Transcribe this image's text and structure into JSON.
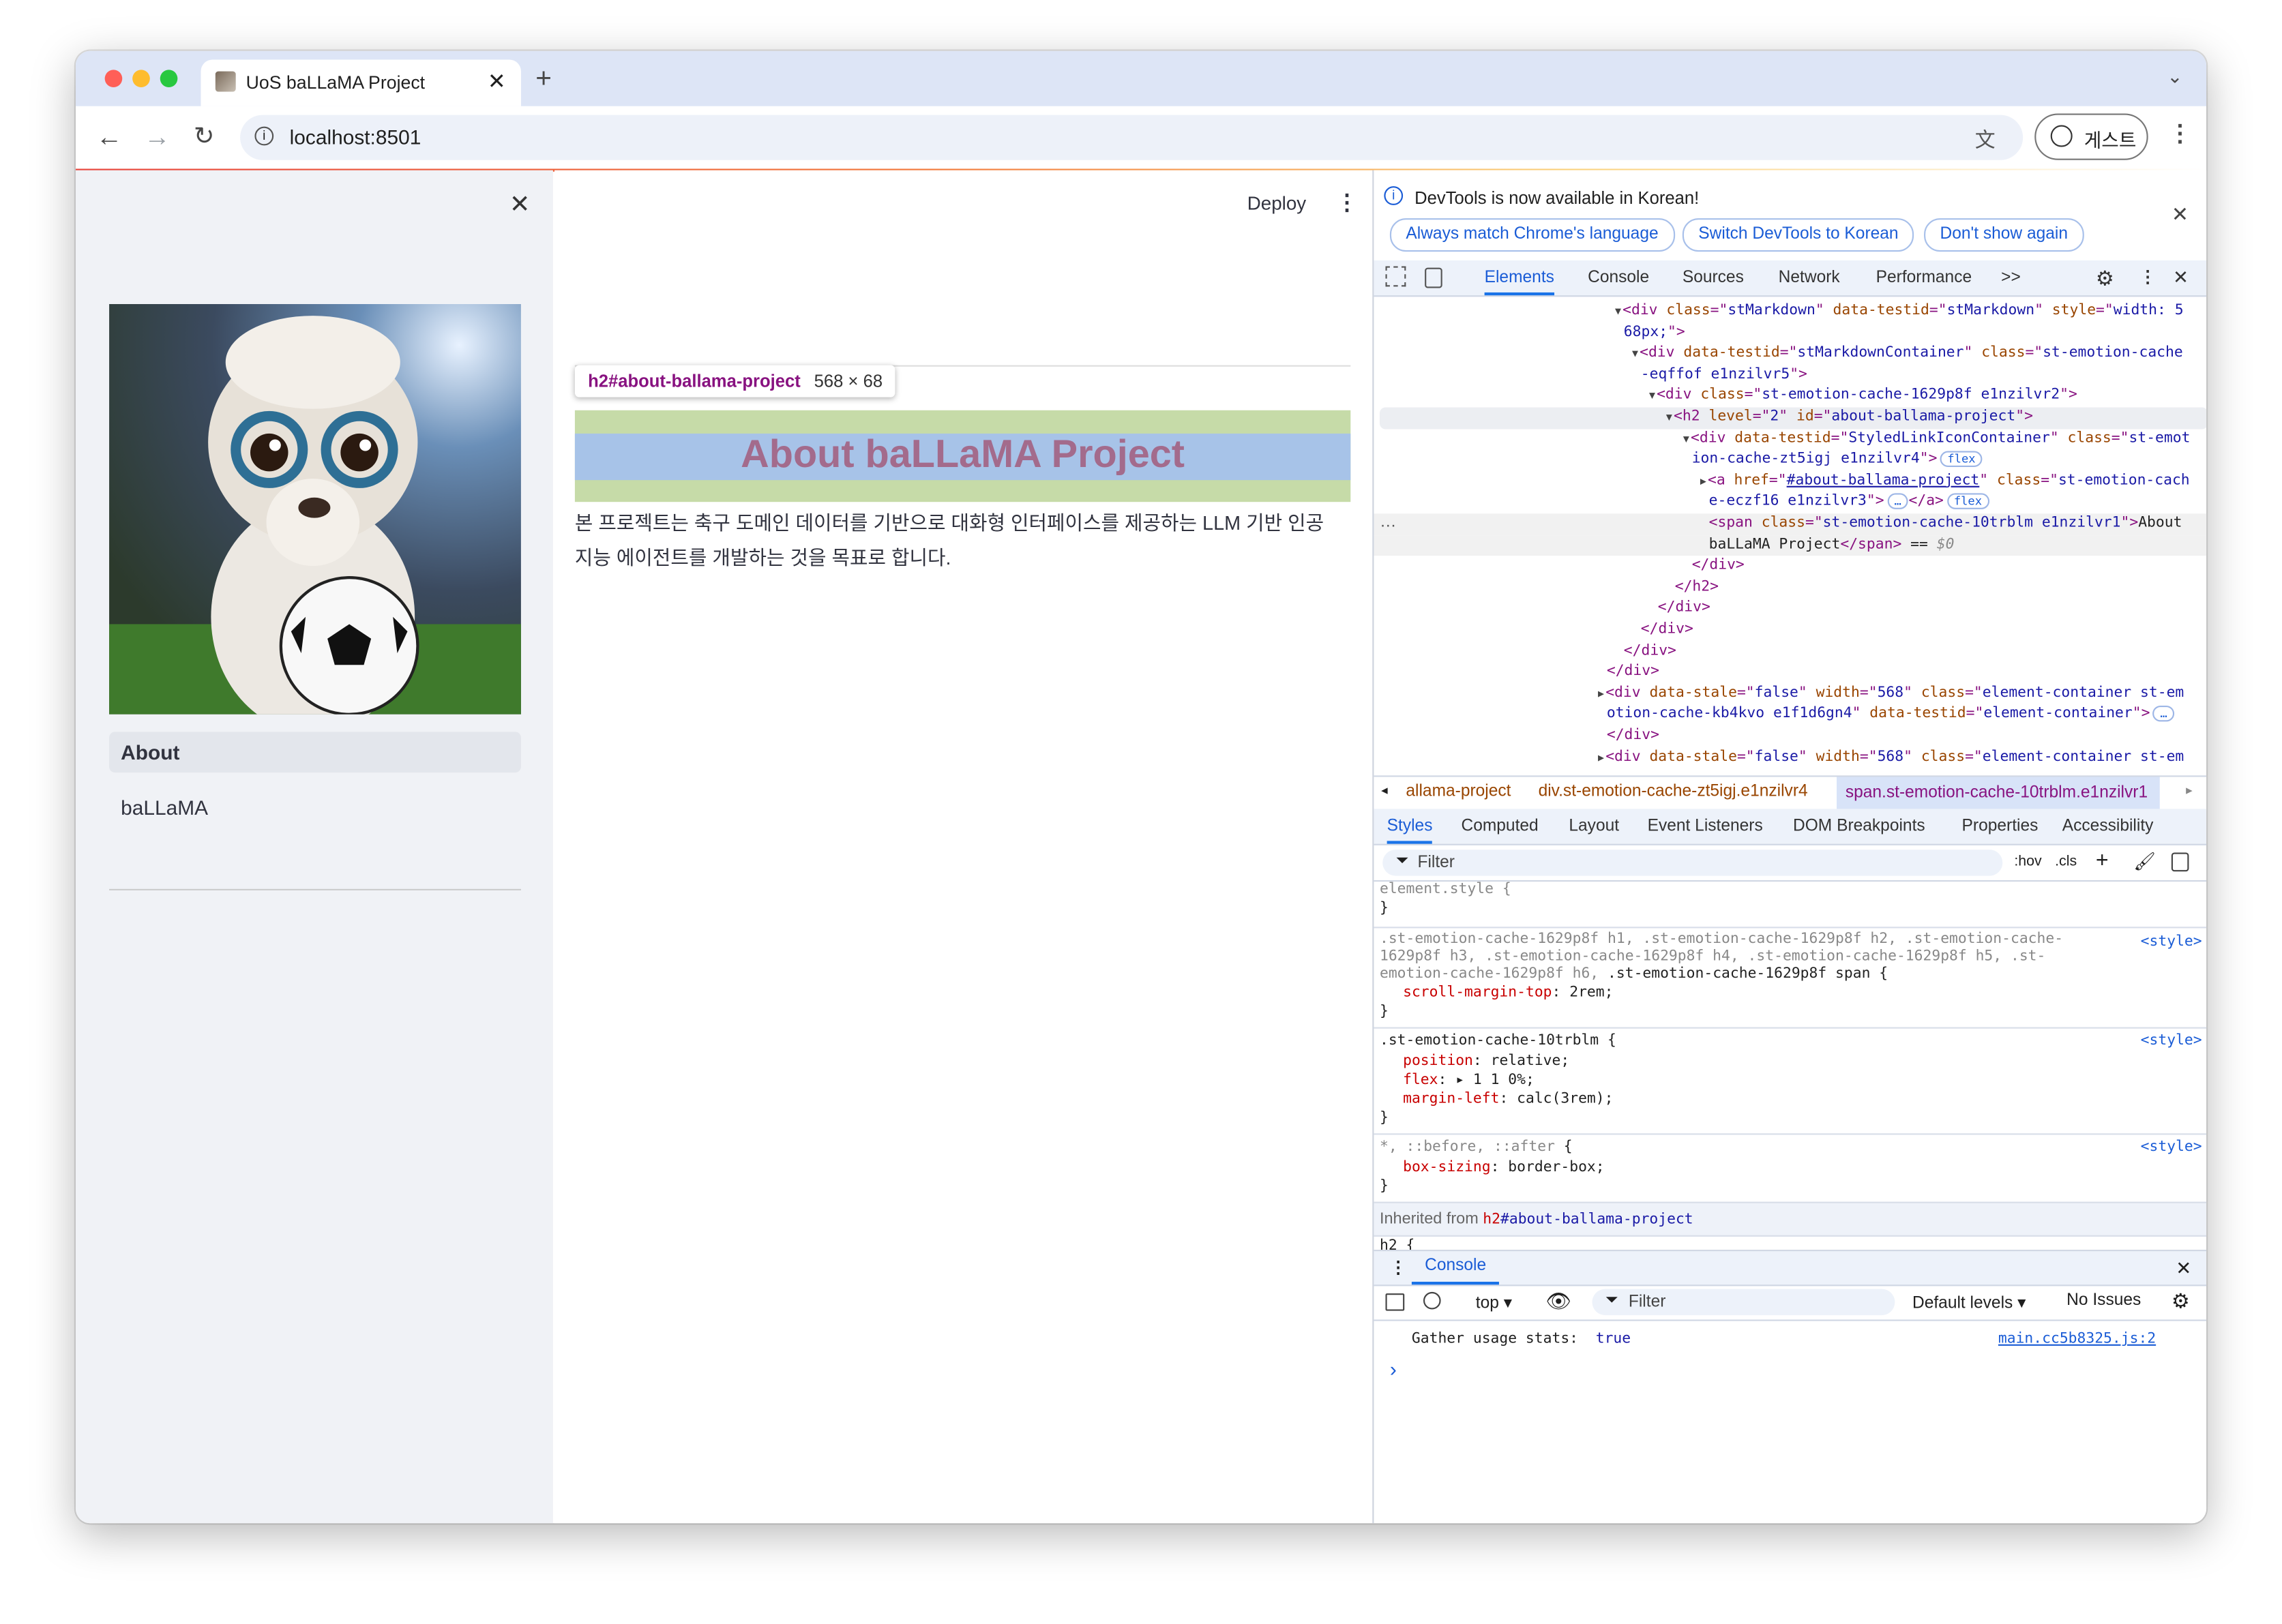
{
  "browser": {
    "tab_title": "UoS baLLaMA Project",
    "url": "localhost:8501",
    "profile_label": "게스트",
    "icons": [
      "back-icon",
      "forward-icon",
      "reload-icon",
      "site-info-icon",
      "translate-icon",
      "profile-icon",
      "menu-icon",
      "new-tab-icon",
      "tab-list-icon"
    ]
  },
  "sidebar": {
    "items": [
      {
        "label": "About",
        "active": true
      },
      {
        "label": "baLLaMA",
        "active": false
      }
    ]
  },
  "main": {
    "deploy_label": "Deploy",
    "tooltip_selector": "h2#about-ballama-project",
    "tooltip_size": "568 × 68",
    "heading": "About baLLaMA Project",
    "paragraph_line1": "본 프로젝트는 축구 도메인 데이터를 기반으로 대화형 인터페이스를 제공하는 LLM 기반 인공",
    "paragraph_line2": "지능 에이전트를 개발하는 것을 목표로 합니다."
  },
  "devtools": {
    "notice": "DevTools is now available in Korean!",
    "notice_buttons": [
      "Always match Chrome's language",
      "Switch DevTools to Korean",
      "Don't show again"
    ],
    "tabs": [
      "Elements",
      "Console",
      "Sources",
      "Network",
      "Performance"
    ],
    "active_tab": "Elements",
    "more_tabs": ">>",
    "dom_lines": [
      {
        "depth": 1,
        "arrow": "down",
        "tokens": [
          [
            "tag",
            "<div "
          ],
          [
            "attr",
            "class"
          ],
          [
            "tag",
            "=\""
          ],
          [
            "val",
            "stMarkdown"
          ],
          [
            "tag",
            "\" "
          ],
          [
            "attr",
            "data-testid"
          ],
          [
            "tag",
            "=\""
          ],
          [
            "val",
            "stMarkdown"
          ],
          [
            "tag",
            "\" "
          ],
          [
            "attr",
            "style"
          ],
          [
            "tag",
            "=\""
          ],
          [
            "val",
            "width: 5"
          ]
        ]
      },
      {
        "depth": 1,
        "arrow": "none",
        "tokens": [
          [
            "val",
            "68px;"
          ],
          [
            "tag",
            "\">"
          ]
        ]
      },
      {
        "depth": 2,
        "arrow": "down",
        "tokens": [
          [
            "tag",
            "<div "
          ],
          [
            "attr",
            "data-testid"
          ],
          [
            "tag",
            "=\""
          ],
          [
            "val",
            "stMarkdownContainer"
          ],
          [
            "tag",
            "\" "
          ],
          [
            "attr",
            "class"
          ],
          [
            "tag",
            "=\""
          ],
          [
            "val",
            "st-emotion-cache"
          ]
        ]
      },
      {
        "depth": 2,
        "arrow": "none",
        "tokens": [
          [
            "val",
            "-eqffof e1nzilvr5"
          ],
          [
            "tag",
            "\">"
          ]
        ]
      },
      {
        "depth": 3,
        "arrow": "down",
        "tokens": [
          [
            "tag",
            "<div "
          ],
          [
            "attr",
            "class"
          ],
          [
            "tag",
            "=\""
          ],
          [
            "val",
            "st-emotion-cache-1629p8f e1nzilvr2"
          ],
          [
            "tag",
            "\">"
          ]
        ]
      },
      {
        "depth": 4,
        "arrow": "down",
        "hover": true,
        "tokens": [
          [
            "tag",
            "<h2 "
          ],
          [
            "attr",
            "level"
          ],
          [
            "tag",
            "=\""
          ],
          [
            "val",
            "2"
          ],
          [
            "tag",
            "\" "
          ],
          [
            "attr",
            "id"
          ],
          [
            "tag",
            "=\""
          ],
          [
            "val",
            "about-ballama-project"
          ],
          [
            "tag",
            "\">"
          ]
        ]
      },
      {
        "depth": 5,
        "arrow": "down",
        "tokens": [
          [
            "tag",
            "<div "
          ],
          [
            "attr",
            "data-testid"
          ],
          [
            "tag",
            "=\""
          ],
          [
            "val",
            "StyledLinkIconContainer"
          ],
          [
            "tag",
            "\" "
          ],
          [
            "attr",
            "class"
          ],
          [
            "tag",
            "=\""
          ],
          [
            "val",
            "st-emot"
          ]
        ]
      },
      {
        "depth": 5,
        "arrow": "none",
        "tokens": [
          [
            "val",
            "ion-cache-zt5igj e1nzilvr4"
          ],
          [
            "tag",
            "\">"
          ],
          [
            "badge",
            "flex"
          ]
        ]
      },
      {
        "depth": 6,
        "arrow": "right",
        "tokens": [
          [
            "tag",
            "<a "
          ],
          [
            "attr",
            "href"
          ],
          [
            "tag",
            "=\""
          ],
          [
            "link",
            "#about-ballama-project"
          ],
          [
            "tag",
            "\" "
          ],
          [
            "attr",
            "class"
          ],
          [
            "tag",
            "=\""
          ],
          [
            "val",
            "st-emotion-cach"
          ]
        ]
      },
      {
        "depth": 6,
        "arrow": "none",
        "tokens": [
          [
            "val",
            "e-eczf16 e1nzilvr3"
          ],
          [
            "tag",
            "\">"
          ],
          [
            "badge",
            "…"
          ],
          [
            "tag",
            "</a>"
          ],
          [
            "badge",
            "flex"
          ]
        ]
      },
      {
        "depth": 6,
        "arrow": "none",
        "selected": true,
        "tokens": [
          [
            "tag",
            "<span "
          ],
          [
            "attr",
            "class"
          ],
          [
            "tag",
            "=\""
          ],
          [
            "val",
            "st-emotion-cache-10trblm e1nzilvr1"
          ],
          [
            "tag",
            "\">"
          ],
          [
            "text",
            "About"
          ]
        ]
      },
      {
        "depth": 6,
        "arrow": "none",
        "selected": true,
        "tokens": [
          [
            "text",
            "baLLaMA Project"
          ],
          [
            "tag",
            "</span>"
          ],
          [
            "text",
            " == "
          ],
          [
            "dim",
            "$0"
          ]
        ]
      },
      {
        "depth": 5,
        "arrow": "none",
        "tokens": [
          [
            "tag",
            "</div>"
          ]
        ]
      },
      {
        "depth": 4,
        "arrow": "none",
        "tokens": [
          [
            "tag",
            "</h2>"
          ]
        ]
      },
      {
        "depth": 3,
        "arrow": "none",
        "tokens": [
          [
            "tag",
            "</div>"
          ]
        ]
      },
      {
        "depth": 2,
        "arrow": "none",
        "tokens": [
          [
            "tag",
            "</div>"
          ]
        ]
      },
      {
        "depth": 1,
        "arrow": "none",
        "tokens": [
          [
            "tag",
            "</div>"
          ]
        ]
      },
      {
        "depth": 0,
        "arrow": "none",
        "tokens": [
          [
            "tag",
            "</div>"
          ]
        ]
      },
      {
        "depth": 0,
        "arrow": "right",
        "tokens": [
          [
            "tag",
            "<div "
          ],
          [
            "attr",
            "data-stale"
          ],
          [
            "tag",
            "=\""
          ],
          [
            "val",
            "false"
          ],
          [
            "tag",
            "\" "
          ],
          [
            "attr",
            "width"
          ],
          [
            "tag",
            "=\""
          ],
          [
            "val",
            "568"
          ],
          [
            "tag",
            "\" "
          ],
          [
            "attr",
            "class"
          ],
          [
            "tag",
            "=\""
          ],
          [
            "val",
            "element-container st-em"
          ]
        ]
      },
      {
        "depth": 0,
        "arrow": "none",
        "tokens": [
          [
            "val",
            "otion-cache-kb4kvo e1f1d6gn4"
          ],
          [
            "tag",
            "\" "
          ],
          [
            "attr",
            "data-testid"
          ],
          [
            "tag",
            "=\""
          ],
          [
            "val",
            "element-container"
          ],
          [
            "tag",
            "\">"
          ],
          [
            "badge",
            "…"
          ]
        ]
      },
      {
        "depth": 0,
        "arrow": "none",
        "tokens": [
          [
            "tag",
            "</div>"
          ]
        ]
      },
      {
        "depth": 0,
        "arrow": "right",
        "tokens": [
          [
            "tag",
            "<div "
          ],
          [
            "attr",
            "data-stale"
          ],
          [
            "tag",
            "=\""
          ],
          [
            "val",
            "false"
          ],
          [
            "tag",
            "\" "
          ],
          [
            "attr",
            "width"
          ],
          [
            "tag",
            "=\""
          ],
          [
            "val",
            "568"
          ],
          [
            "tag",
            "\" "
          ],
          [
            "attr",
            "class"
          ],
          [
            "tag",
            "=\""
          ],
          [
            "val",
            "element-container st-em"
          ]
        ]
      }
    ],
    "breadcrumbs": [
      "allama-project",
      "div.st-emotion-cache-zt5igj.e1nzilvr4",
      "span.st-emotion-cache-10trblm.e1nzilvr1"
    ],
    "style_tabs": [
      "Styles",
      "Computed",
      "Layout",
      "Event Listeners",
      "DOM Breakpoints",
      "Properties",
      "Accessibility"
    ],
    "filter_placeholder": "Filter",
    "hov_label": ":hov",
    "cls_label": ".cls",
    "styles": {
      "element_style": "element.style {",
      "close": "}",
      "rule1_sel1": ".st-emotion-cache-1629p8f h1, .st-emotion-cache-1629p8f h2, .st-emotion-cache-",
      "rule1_sel2": "1629p8f h3, .st-emotion-cache-1629p8f h4, .st-emotion-cache-1629p8f h5, .st-",
      "rule1_sel3a": "emotion-cache-1629p8f h6, ",
      "rule1_sel3b": ".st-emotion-cache-1629p8f span {",
      "rule1_prop": "scroll-margin-top",
      "rule1_val": ": 2rem;",
      "rule2_sel": ".st-emotion-cache-10trblm {",
      "rule2_props": [
        [
          "position",
          ": relative;"
        ],
        [
          "flex",
          ": ▸ 1 1 0%;"
        ],
        [
          "margin-left",
          ": calc(3rem);"
        ]
      ],
      "rule3_sel_a": "*, ::before, ::after",
      "rule3_sel_b": " {",
      "rule3_prop": "box-sizing",
      "rule3_val": ": border-box;",
      "source": "<style>",
      "inherited_label": "Inherited from ",
      "inherited_tag": "h2",
      "inherited_id": "#about-ballama-project",
      "next_rule": "h2 {"
    },
    "console": {
      "title": "Console",
      "context": "top ▾",
      "filter_placeholder": "Filter",
      "levels": "Default levels ▾",
      "issues": "No Issues",
      "log_text": "Gather usage stats:",
      "log_value": "true",
      "log_source": "main.cc5b8325.js:2",
      "prompt": "›"
    }
  },
  "colors": {
    "accent": "#1a73e8",
    "heading_overlay": "#a36b8c",
    "margin_highlight": "#c6dba8",
    "content_highlight": "#a7c3e8",
    "sidebar_bg": "#f0f2f6"
  }
}
